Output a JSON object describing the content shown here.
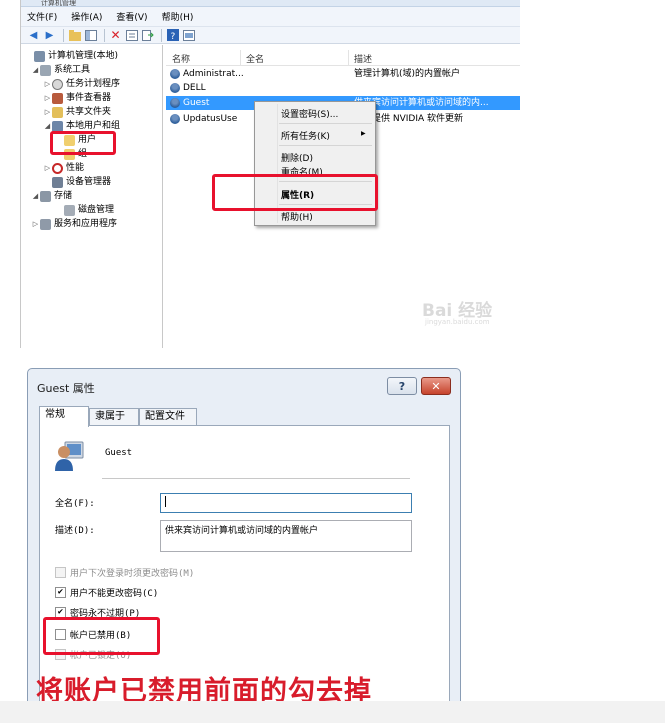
{
  "mmc": {
    "title": "计算机管理",
    "menu": [
      "文件(F)",
      "操作(A)",
      "查看(V)",
      "帮助(H)"
    ],
    "tree": [
      {
        "label": "计算机管理(本地)",
        "expander": ""
      },
      {
        "label": "系统工具",
        "expander": "◢"
      },
      {
        "label": "任务计划程序",
        "expander": "▷"
      },
      {
        "label": "事件查看器",
        "expander": "▷"
      },
      {
        "label": "共享文件夹",
        "expander": "▷"
      },
      {
        "label": "本地用户和组",
        "expander": "◢"
      },
      {
        "label": "用户",
        "expander": ""
      },
      {
        "label": "组",
        "expander": ""
      },
      {
        "label": "性能",
        "expander": "▷"
      },
      {
        "label": "设备管理器",
        "expander": ""
      },
      {
        "label": "存储",
        "expander": "◢"
      },
      {
        "label": "磁盘管理",
        "expander": ""
      },
      {
        "label": "服务和应用程序",
        "expander": "▷"
      }
    ],
    "list_headers": {
      "name": "名称",
      "fullname": "全名",
      "desc": "描述"
    },
    "rows": [
      {
        "name": "Administrat...",
        "desc": "管理计算机(域)的内置帐户"
      },
      {
        "name": "DELL",
        "desc": ""
      },
      {
        "name": "Guest",
        "desc": "供来宾访问计算机或访问域的内..."
      },
      {
        "name": "UpdatusUse",
        "desc": "用于提供 NVIDIA 软件更新"
      }
    ],
    "context_menu": {
      "set_password": "设置密码(S)...",
      "all_tasks": "所有任务(K)",
      "submenu_arrow": "▶",
      "delete": "删除(D)",
      "rename": "重命名(M)",
      "properties": "属性(R)",
      "help": "帮助(H)"
    },
    "watermark": "Bai 经验",
    "watermark_url": "jingyan.baidu.com"
  },
  "dialog": {
    "title": "Guest 属性",
    "help_btn": "?",
    "close_btn": "✕",
    "tabs": [
      "常规",
      "隶属于",
      "配置文件"
    ],
    "username": "Guest",
    "fullname_label": "全名(F):",
    "fullname_value": "",
    "desc_label": "描述(D):",
    "desc_value": "供来宾访问计算机或访问域的内置帐户",
    "checkboxes": {
      "must_change": {
        "label": "用户下次登录时须更改密码(M)",
        "checked": false
      },
      "cannot_change": {
        "label": "用户不能更改密码(C)",
        "checked": true
      },
      "never_expires": {
        "label": "密码永不过期(P)",
        "checked": true
      },
      "disabled": {
        "label": "帐户已禁用(B)",
        "checked": false
      },
      "locked": {
        "label": "帐户已锁定(O)",
        "checked": false
      }
    },
    "check_mark": "✔"
  },
  "caption": "将账户已禁用前面的勾去掉",
  "colors": {
    "highlight": "#e8112d",
    "selection": "#3399ff",
    "caption": "#d81c2b"
  }
}
